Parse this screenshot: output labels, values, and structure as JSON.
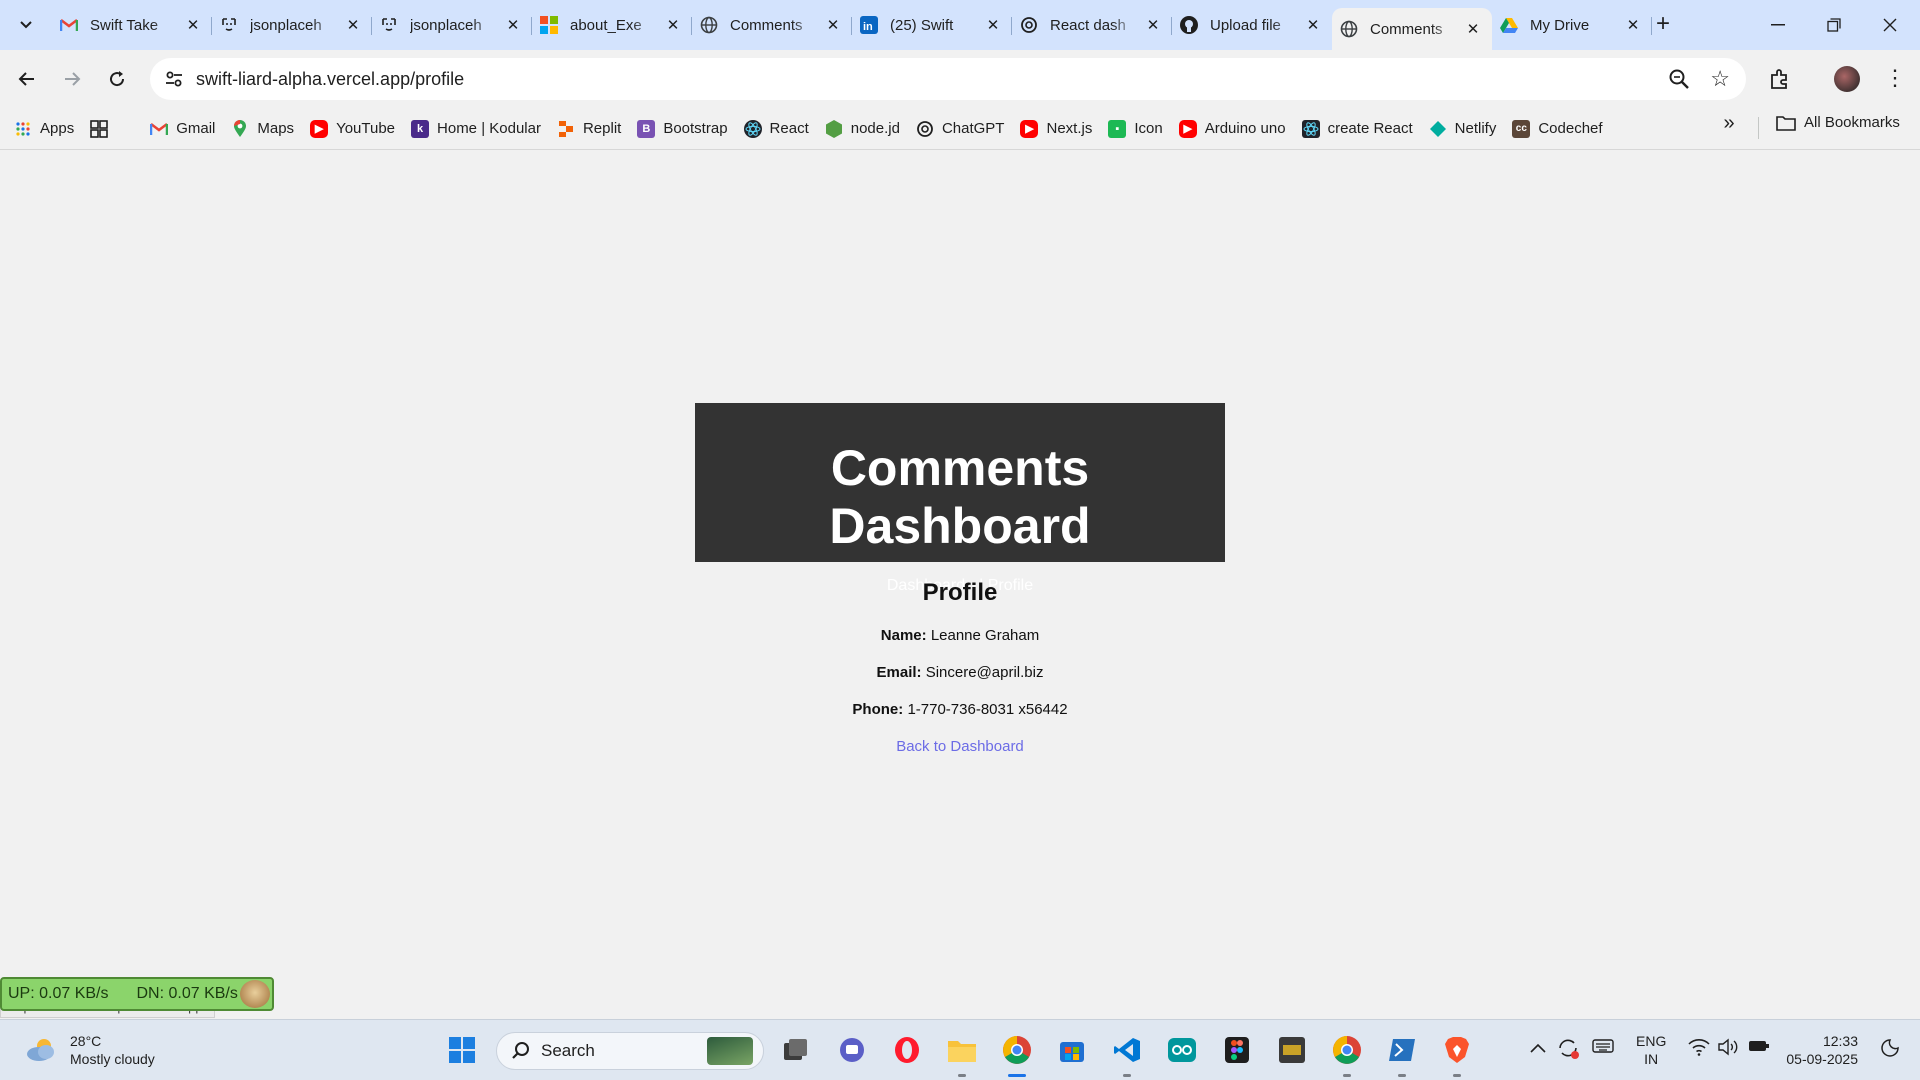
{
  "browser": {
    "tabs": [
      {
        "title": "Swift Take",
        "icon": "gmail-icon"
      },
      {
        "title": "jsonplaceh",
        "icon": "jsonplaceholder-icon"
      },
      {
        "title": "jsonplaceh",
        "icon": "jsonplaceholder-icon"
      },
      {
        "title": "about_Exe",
        "icon": "microsoft-icon"
      },
      {
        "title": "Comments",
        "icon": "globe-icon"
      },
      {
        "title": "(25) Swift",
        "icon": "linkedin-icon"
      },
      {
        "title": "React dash",
        "icon": "chatgpt-icon"
      },
      {
        "title": "Upload file",
        "icon": "github-icon"
      },
      {
        "title": "Comments",
        "icon": "globe-icon",
        "active": true
      },
      {
        "title": "My Drive",
        "icon": "drive-icon"
      }
    ],
    "url": "swift-liard-alpha.vercel.app/profile",
    "bookmarks": [
      {
        "label": "Apps",
        "icon": "apps-grid-icon"
      },
      {
        "label": "",
        "icon": "tab-groups-icon"
      },
      {
        "label": "Gmail",
        "icon": "gmail-icon"
      },
      {
        "label": "Maps",
        "icon": "maps-icon"
      },
      {
        "label": "YouTube",
        "icon": "youtube-icon"
      },
      {
        "label": "Home | Kodular",
        "icon": "kodular-icon"
      },
      {
        "label": "Replit",
        "icon": "replit-icon"
      },
      {
        "label": "Bootstrap",
        "icon": "bootstrap-icon"
      },
      {
        "label": "React",
        "icon": "react-icon"
      },
      {
        "label": "node.jd",
        "icon": "nodejs-icon"
      },
      {
        "label": "ChatGPT",
        "icon": "chatgpt-icon"
      },
      {
        "label": "Next.js",
        "icon": "youtube-icon"
      },
      {
        "label": "Icon",
        "icon": "icon-site-icon"
      },
      {
        "label": "Arduino uno",
        "icon": "youtube-icon"
      },
      {
        "label": "create React",
        "icon": "react-icon"
      },
      {
        "label": "Netlify",
        "icon": "netlify-icon"
      },
      {
        "label": "Codechef",
        "icon": "codechef-icon"
      }
    ],
    "all_bookmarks": "All Bookmarks"
  },
  "page": {
    "title": "Comments Dashboard",
    "nav": {
      "dashboard": "Dashboard",
      "profile": "| Profile"
    },
    "profile": {
      "heading": "Profile",
      "name_label": "Name:",
      "name": "Leanne Graham",
      "email_label": "Email:",
      "email": "Sincere@april.biz",
      "phone_label": "Phone:",
      "phone": "1-770-736-8031 x56442",
      "back_link": "Back to Dashboard"
    }
  },
  "overlay": {
    "status_url": "https://swift-liard-alpha.vercel.app/",
    "up": "UP: 0.07 KB/s",
    "dn": "DN: 0.07 KB/s"
  },
  "taskbar": {
    "weather_temp": "28°C",
    "weather_desc": "Mostly cloudy",
    "search_label": "Search",
    "lang_top": "ENG",
    "lang_bottom": "IN",
    "time": "12:33",
    "date": "05-09-2025"
  },
  "colors": {
    "tabstrip": "#d3e3fd",
    "header_bg": "#333333",
    "link": "#6c6ce6",
    "page_bg": "#f1f1f1"
  }
}
